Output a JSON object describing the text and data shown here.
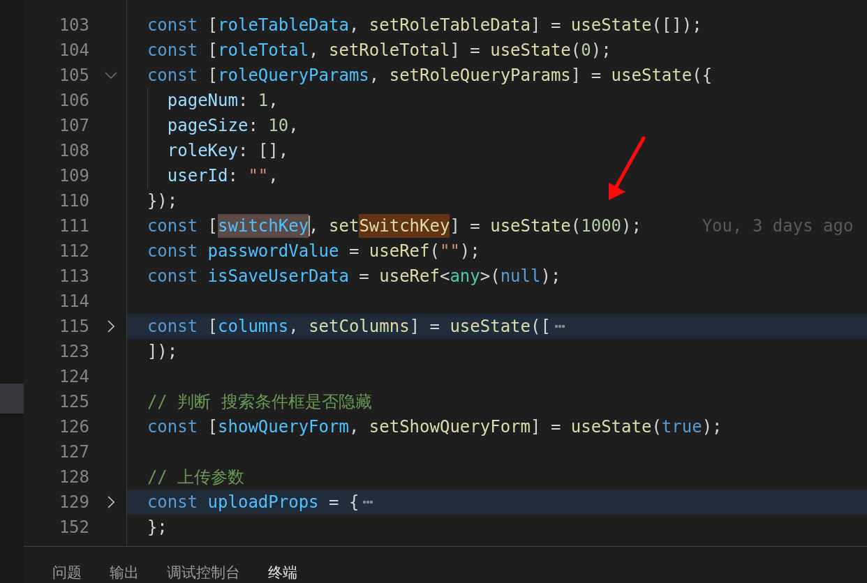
{
  "sidebar": {
    "items": [
      {
        "selected": false
      },
      {
        "selected": false
      },
      {
        "selected": false
      },
      {
        "selected": false
      },
      {
        "selected": false
      },
      {
        "selected": false
      },
      {
        "selected": false
      },
      {
        "selected": false
      },
      {
        "selected": false
      },
      {
        "selected": false
      },
      {
        "selected": false
      },
      {
        "selected": false
      },
      {
        "selected": true
      }
    ]
  },
  "editor": {
    "lines": [
      {
        "number": "103",
        "tokens": [
          {
            "text": "  const",
            "kind": "keyword"
          },
          {
            "text": " [",
            "kind": "plain"
          },
          {
            "text": "roleTableData",
            "kind": "variable"
          },
          {
            "text": ", ",
            "kind": "plain"
          },
          {
            "text": "setRoleTableData",
            "kind": "function"
          },
          {
            "text": "] = ",
            "kind": "plain"
          },
          {
            "text": "useState",
            "kind": "function"
          },
          {
            "text": "([]);",
            "kind": "plain"
          }
        ]
      },
      {
        "number": "104",
        "tokens": [
          {
            "text": "  const",
            "kind": "keyword"
          },
          {
            "text": " [",
            "kind": "plain"
          },
          {
            "text": "roleTotal",
            "kind": "variable"
          },
          {
            "text": ", ",
            "kind": "plain"
          },
          {
            "text": "setRoleTotal",
            "kind": "function"
          },
          {
            "text": "] = ",
            "kind": "plain"
          },
          {
            "text": "useState",
            "kind": "function"
          },
          {
            "text": "(",
            "kind": "plain"
          },
          {
            "text": "0",
            "kind": "number"
          },
          {
            "text": ");",
            "kind": "plain"
          }
        ]
      },
      {
        "number": "105",
        "expanded": true,
        "tokens": [
          {
            "text": "  const",
            "kind": "keyword"
          },
          {
            "text": " [",
            "kind": "plain"
          },
          {
            "text": "roleQueryParams",
            "kind": "variable"
          },
          {
            "text": ", ",
            "kind": "plain"
          },
          {
            "text": "setRoleQueryParams",
            "kind": "function"
          },
          {
            "text": "] = ",
            "kind": "plain"
          },
          {
            "text": "useState",
            "kind": "function"
          },
          {
            "text": "({",
            "kind": "plain"
          }
        ]
      },
      {
        "number": "106",
        "tokens": [
          {
            "text": "    pageNum",
            "kind": "property"
          },
          {
            "text": ": ",
            "kind": "plain"
          },
          {
            "text": "1",
            "kind": "number"
          },
          {
            "text": ",",
            "kind": "plain"
          }
        ]
      },
      {
        "number": "107",
        "tokens": [
          {
            "text": "    pageSize",
            "kind": "property"
          },
          {
            "text": ": ",
            "kind": "plain"
          },
          {
            "text": "10",
            "kind": "number"
          },
          {
            "text": ",",
            "kind": "plain"
          }
        ]
      },
      {
        "number": "108",
        "tokens": [
          {
            "text": "    roleKey",
            "kind": "property"
          },
          {
            "text": ": [],",
            "kind": "plain"
          }
        ]
      },
      {
        "number": "109",
        "tokens": [
          {
            "text": "    userId",
            "kind": "property"
          },
          {
            "text": ": ",
            "kind": "plain"
          },
          {
            "text": "\"\"",
            "kind": "string"
          },
          {
            "text": ",",
            "kind": "plain"
          }
        ]
      },
      {
        "number": "110",
        "tokens": [
          {
            "text": "  });",
            "kind": "plain"
          }
        ]
      },
      {
        "number": "111",
        "blame": "You, 3 days ago",
        "tokens": [
          {
            "text": "  const",
            "kind": "keyword"
          },
          {
            "text": " [",
            "kind": "plain"
          },
          {
            "text": "switchKey",
            "kind": "variable",
            "selected": true,
            "cursor": true
          },
          {
            "text": ", ",
            "kind": "plain"
          },
          {
            "text": "set",
            "kind": "function"
          },
          {
            "text": "SwitchKey",
            "kind": "function",
            "highlighted": true
          },
          {
            "text": "] = ",
            "kind": "plain"
          },
          {
            "text": "useState",
            "kind": "function"
          },
          {
            "text": "(",
            "kind": "plain"
          },
          {
            "text": "1000",
            "kind": "number"
          },
          {
            "text": ");",
            "kind": "plain"
          }
        ]
      },
      {
        "number": "112",
        "tokens": [
          {
            "text": "  const ",
            "kind": "keyword"
          },
          {
            "text": "passwordValue",
            "kind": "variable"
          },
          {
            "text": " = ",
            "kind": "plain"
          },
          {
            "text": "useRef",
            "kind": "function"
          },
          {
            "text": "(",
            "kind": "plain"
          },
          {
            "text": "\"\"",
            "kind": "string"
          },
          {
            "text": ");",
            "kind": "plain"
          }
        ]
      },
      {
        "number": "113",
        "tokens": [
          {
            "text": "  const ",
            "kind": "keyword"
          },
          {
            "text": "isSaveUserData",
            "kind": "variable"
          },
          {
            "text": " = ",
            "kind": "plain"
          },
          {
            "text": "useRef",
            "kind": "function"
          },
          {
            "text": "<",
            "kind": "plain"
          },
          {
            "text": "any",
            "kind": "type"
          },
          {
            "text": ">(",
            "kind": "plain"
          },
          {
            "text": "null",
            "kind": "keyword"
          },
          {
            "text": ");",
            "kind": "plain"
          }
        ]
      },
      {
        "number": "114"
      },
      {
        "number": "115",
        "expanded": false,
        "tokens": [
          {
            "text": "  const",
            "kind": "keyword"
          },
          {
            "text": " [",
            "kind": "plain"
          },
          {
            "text": "columns",
            "kind": "variable"
          },
          {
            "text": ", ",
            "kind": "plain"
          },
          {
            "text": "setColumns",
            "kind": "function"
          },
          {
            "text": "] = ",
            "kind": "plain"
          },
          {
            "text": "useState",
            "kind": "function"
          },
          {
            "text": "([",
            "kind": "plain"
          }
        ]
      },
      {
        "number": "123",
        "tokens": [
          {
            "text": "  ]);",
            "kind": "plain"
          }
        ]
      },
      {
        "number": "124"
      },
      {
        "number": "125",
        "tokens": [
          {
            "text": "  // 判断 搜索条件框是否隐藏",
            "kind": "comment"
          }
        ]
      },
      {
        "number": "126",
        "tokens": [
          {
            "text": "  const",
            "kind": "keyword"
          },
          {
            "text": " [",
            "kind": "plain"
          },
          {
            "text": "showQueryForm",
            "kind": "variable"
          },
          {
            "text": ", ",
            "kind": "plain"
          },
          {
            "text": "setShowQueryForm",
            "kind": "function"
          },
          {
            "text": "] = ",
            "kind": "plain"
          },
          {
            "text": "useState",
            "kind": "function"
          },
          {
            "text": "(",
            "kind": "plain"
          },
          {
            "text": "true",
            "kind": "keyword"
          },
          {
            "text": ");",
            "kind": "plain"
          }
        ]
      },
      {
        "number": "127"
      },
      {
        "number": "128",
        "tokens": [
          {
            "text": "  // 上传参数",
            "kind": "comment"
          }
        ]
      },
      {
        "number": "129",
        "expanded": false,
        "tokens": [
          {
            "text": "  const ",
            "kind": "keyword"
          },
          {
            "text": "uploadProps",
            "kind": "variable"
          },
          {
            "text": " = {",
            "kind": "plain"
          }
        ]
      },
      {
        "number": "152",
        "tokens": [
          {
            "text": "  };",
            "kind": "plain"
          }
        ]
      }
    ]
  },
  "panel": {
    "tabs": [
      {
        "label": "问题",
        "selected": false
      },
      {
        "label": "输出",
        "selected": false
      },
      {
        "label": "调试控制台",
        "selected": false
      },
      {
        "label": "终端",
        "selected": true
      }
    ]
  }
}
